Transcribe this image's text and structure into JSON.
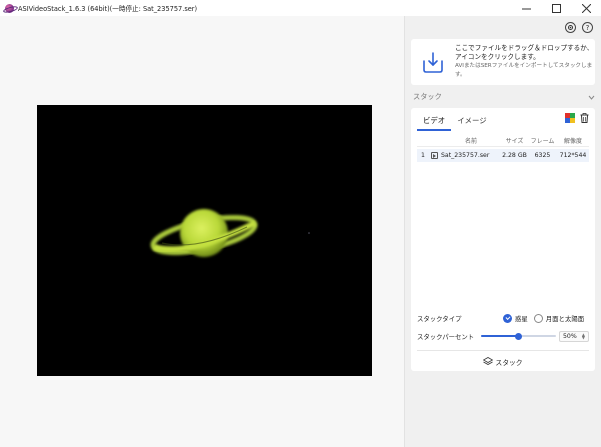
{
  "window": {
    "title": "ASIVideoStack_1.6.3 (64bit)(一時停止: Sat_235757.ser)",
    "controls": {
      "minimize_icon": "minimize-icon",
      "maximize_icon": "maximize-icon",
      "close_icon": "close-icon"
    }
  },
  "toolbar": {
    "settings_icon": "settings-icon",
    "help_label": "?"
  },
  "drop_zone": {
    "main_text": "ここでファイルをドラッグ＆ドロップするか、アイコンをクリックします。",
    "sub_text": "AVIまたはSERファイルをインポートしてスタックします。"
  },
  "stack_section": {
    "title": "スタック",
    "tabs": [
      {
        "label": "ビデオ",
        "active": true
      },
      {
        "label": "イメージ",
        "active": false
      }
    ],
    "table": {
      "headers": {
        "name": "名前",
        "size": "サイズ",
        "frames": "フレーム",
        "resolution": "解像度"
      },
      "rows": [
        {
          "index": "1",
          "name": "Sat_235757.ser",
          "size": "2.28 GB",
          "frames": "6325",
          "resolution": "712*544"
        }
      ]
    },
    "stack_type": {
      "label": "スタックタイプ",
      "options": [
        {
          "label": "惑星",
          "selected": true
        },
        {
          "label": "月面と太陽面",
          "selected": false
        }
      ]
    },
    "stack_percent": {
      "label": "スタックパーセント",
      "value": 50,
      "display": "50%"
    },
    "stack_button": {
      "label": "スタック"
    }
  },
  "preview": {
    "planet_color": "#c8e63c",
    "background": "#000000"
  },
  "colors": {
    "accent": "#2f62d6"
  }
}
